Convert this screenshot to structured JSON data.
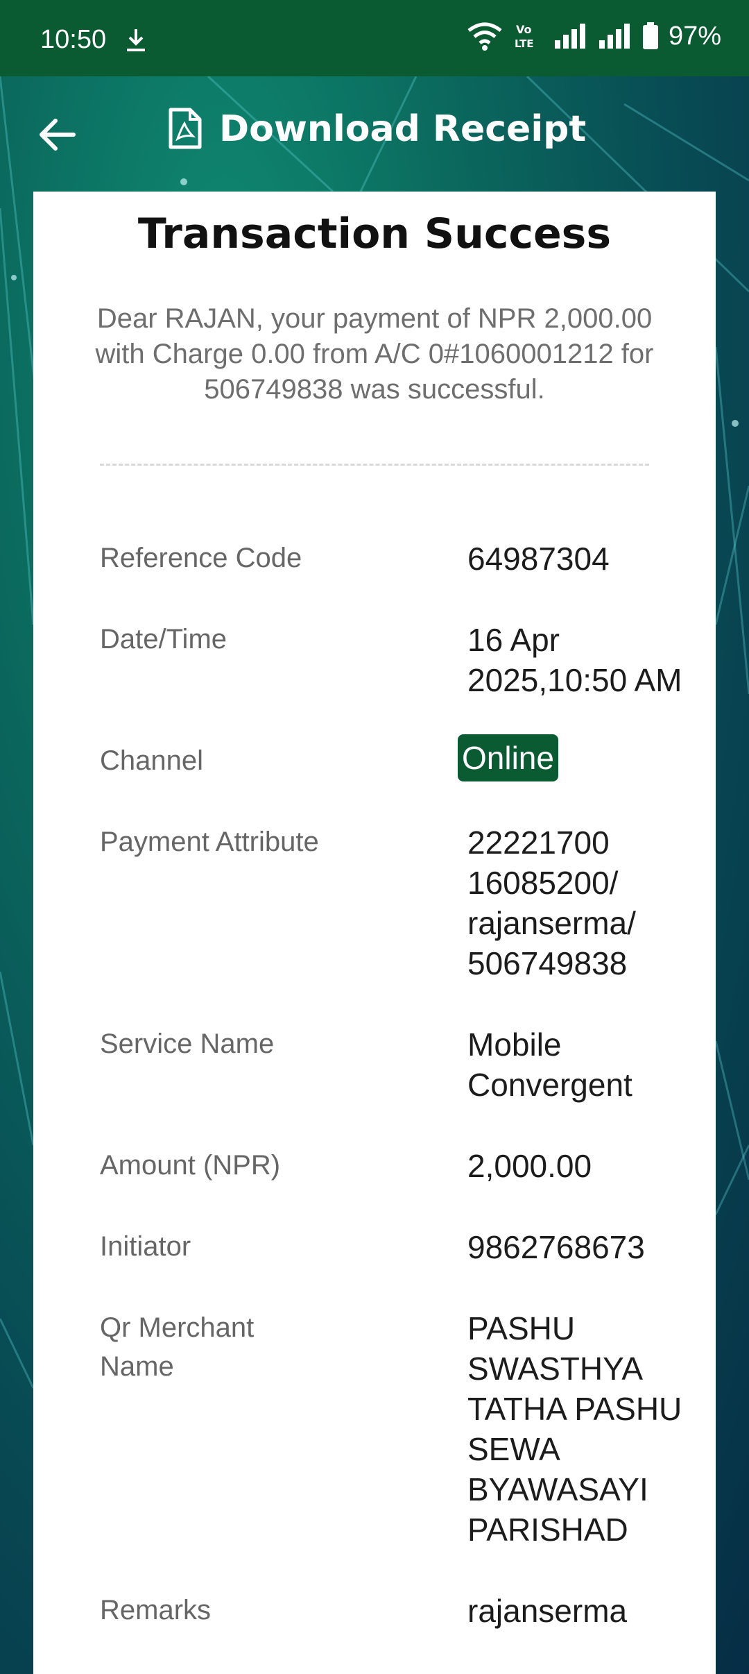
{
  "status_bar": {
    "time": "10:50",
    "battery": "97%",
    "icons": [
      "download-icon",
      "wifi-icon",
      "volte-icon",
      "signal-icon",
      "signal-icon",
      "battery-icon"
    ]
  },
  "app_bar": {
    "title": "Download Receipt",
    "icons": [
      "back-arrow-icon",
      "pdf-icon"
    ]
  },
  "receipt": {
    "heading": "Transaction Success",
    "message": "Dear RAJAN, your payment of NPR 2,000.00 with Charge 0.00 from A/C 0#1060001212 for 506749838 was successful.",
    "rows": [
      {
        "label": "Reference Code",
        "value": "64987304"
      },
      {
        "label": "Date/Time",
        "value": "16 Apr 2025,10:50 AM"
      },
      {
        "label": "Channel",
        "value": "Online"
      },
      {
        "label": "Payment Attribute",
        "value": "22221700 16085200/ rajanserma/ 506749838"
      },
      {
        "label": "Service Name",
        "value": "Mobile Convergent"
      },
      {
        "label": "Amount (NPR)",
        "value": "2,000.00"
      },
      {
        "label": "Initiator",
        "value": "9862768673"
      },
      {
        "label": "Qr Merchant Name",
        "value": "PASHU SWASTHYA TATHA PASHU SEWA BYAWASAYI PARISHAD"
      },
      {
        "label": "Remarks",
        "value": "rajanserma"
      }
    ]
  },
  "colors": {
    "status_bar": "#0a5a32",
    "badge": "#0a5a32",
    "card": "#ffffff"
  }
}
